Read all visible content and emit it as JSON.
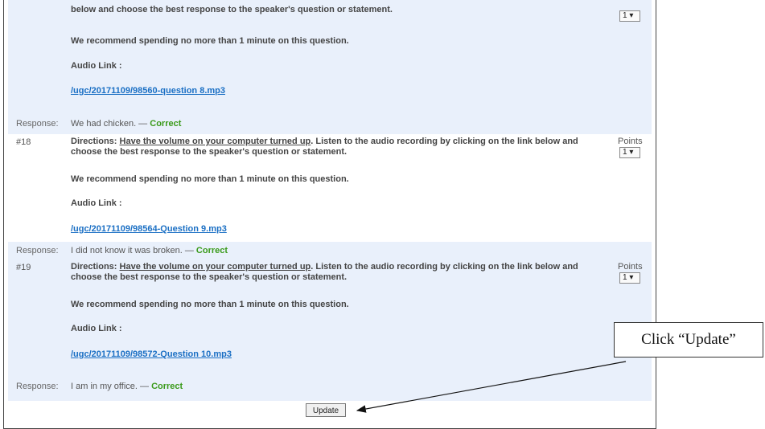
{
  "questions": [
    {
      "number": "",
      "directions_line2": "below and choose the best response to the speaker's question or statement.",
      "recommend": "We recommend spending no more than 1 minute on this question.",
      "audio_label": "Audio Link :",
      "audio_link": "/ugc/20171109/98560-question 8.mp3",
      "points_label": "",
      "points_value": "1 ▾",
      "response_label": "Response:",
      "response_text": "We had chicken. —",
      "response_status": "Correct"
    },
    {
      "number": "#18",
      "directions_prefix": "Directions: ",
      "directions_underlined": "Have the volume on your computer turned up",
      "directions_rest": ". Listen to the audio recording by clicking on the link below and choose the best response to the speaker's question or statement.",
      "recommend": "We recommend spending no more than 1 minute on this question.",
      "audio_label": "Audio Link :",
      "audio_link": "/ugc/20171109/98564-Question 9.mp3",
      "points_label": "Points",
      "points_value": "1 ▾",
      "response_label": "Response:",
      "response_text": "I did not know it was broken. —",
      "response_status": "Correct"
    },
    {
      "number": "#19",
      "directions_prefix": "Directions: ",
      "directions_underlined": "Have the volume on your computer turned up",
      "directions_rest": ". Listen to the audio recording by clicking on the link below and choose the best response to the speaker's question or statement.",
      "recommend": "We recommend spending no more than 1 minute on this question.",
      "audio_label": "Audio Link :",
      "audio_link": "/ugc/20171109/98572-Question 10.mp3",
      "points_label": "Points",
      "points_value": "1 ▾",
      "response_label": "Response:",
      "response_text": "I am in my office. —",
      "response_status": "Correct"
    }
  ],
  "update_button": "Update",
  "callout_text": "Click “Update”"
}
